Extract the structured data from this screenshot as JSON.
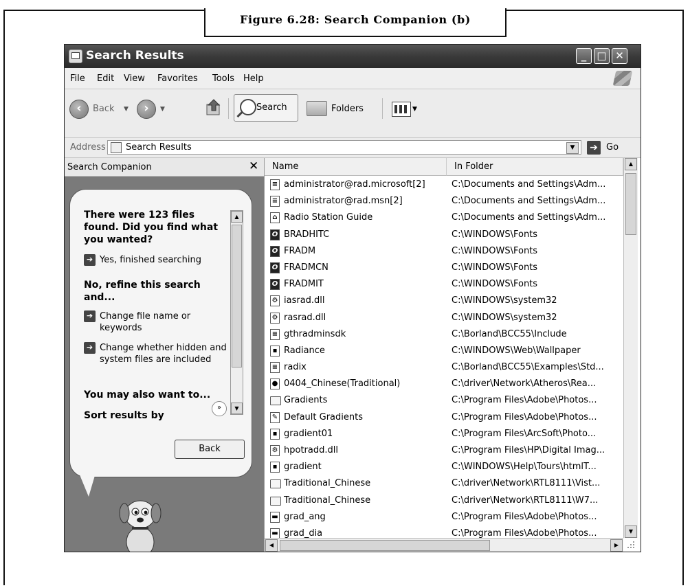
{
  "figure": {
    "caption": "Figure 6.28: Search Companion (b)"
  },
  "window": {
    "title": "Search Results"
  },
  "menu": [
    "File",
    "Edit",
    "View",
    "Favorites",
    "Tools",
    "Help"
  ],
  "toolbar": {
    "back": "Back",
    "search": "Search",
    "folders": "Folders"
  },
  "address": {
    "label": "Address",
    "value": "Search Results",
    "go": "Go"
  },
  "companion": {
    "panel_title": "Search Companion",
    "heading_found": "There were 123 files found. Did you find what you wanted?",
    "link_finished": "Yes, finished searching",
    "heading_refine": "No, refine this search and...",
    "link_change_name": "Change file name or keywords",
    "link_change_hidden": "Change whether hidden and system files are included",
    "heading_also": "You may also want to...",
    "heading_sort": "Sort results by category",
    "back_button": "Back"
  },
  "list": {
    "columns": {
      "name": "Name",
      "folder": "In Folder"
    },
    "rows": [
      {
        "name": "administrator@rad.microsoft[2]",
        "folder": "C:\\Documents and Settings\\Adm...",
        "icon": "text-file-icon"
      },
      {
        "name": "administrator@rad.msn[2]",
        "folder": "C:\\Documents and Settings\\Adm...",
        "icon": "text-file-icon"
      },
      {
        "name": "Radio Station Guide",
        "folder": "C:\\Documents and Settings\\Adm...",
        "icon": "shortcut-icon"
      },
      {
        "name": "BRADHITC",
        "folder": "C:\\WINDOWS\\Fonts",
        "icon": "font-icon"
      },
      {
        "name": "FRADM",
        "folder": "C:\\WINDOWS\\Fonts",
        "icon": "font-icon"
      },
      {
        "name": "FRADMCN",
        "folder": "C:\\WINDOWS\\Fonts",
        "icon": "font-icon"
      },
      {
        "name": "FRADMIT",
        "folder": "C:\\WINDOWS\\Fonts",
        "icon": "font-icon"
      },
      {
        "name": "iasrad.dll",
        "folder": "C:\\WINDOWS\\system32",
        "icon": "dll-icon"
      },
      {
        "name": "rasrad.dll",
        "folder": "C:\\WINDOWS\\system32",
        "icon": "dll-icon"
      },
      {
        "name": "gthradminsdk",
        "folder": "C:\\Borland\\BCC55\\Include",
        "icon": "text-file-icon"
      },
      {
        "name": "Radiance",
        "folder": "C:\\WINDOWS\\Web\\Wallpaper",
        "icon": "image-icon"
      },
      {
        "name": "radix",
        "folder": "C:\\Borland\\BCC55\\Examples\\Std...",
        "icon": "text-file-icon"
      },
      {
        "name": "0404_Chinese(Traditional)",
        "folder": "C:\\driver\\Network\\Atheros\\Rea...",
        "icon": "media-icon"
      },
      {
        "name": "Gradients",
        "folder": "C:\\Program Files\\Adobe\\Photos...",
        "icon": "folder-icon"
      },
      {
        "name": "Default Gradients",
        "folder": "C:\\Program Files\\Adobe\\Photos...",
        "icon": "photoshop-icon"
      },
      {
        "name": "gradient01",
        "folder": "C:\\Program Files\\ArcSoft\\Photo...",
        "icon": "image-icon"
      },
      {
        "name": "hpotradd.dll",
        "folder": "C:\\Program Files\\HP\\Digital Imag...",
        "icon": "dll-icon"
      },
      {
        "name": "gradient",
        "folder": "C:\\WINDOWS\\Help\\Tours\\htmlT...",
        "icon": "image-icon"
      },
      {
        "name": "Traditional_Chinese",
        "folder": "C:\\driver\\Network\\RTL8111\\Vist...",
        "icon": "folder-icon"
      },
      {
        "name": "Traditional_Chinese",
        "folder": "C:\\driver\\Network\\RTL8111\\W7...",
        "icon": "folder-icon"
      },
      {
        "name": "grad_ang",
        "folder": "C:\\Program Files\\Adobe\\Photos...",
        "icon": "generic-file-icon"
      },
      {
        "name": "grad_dia",
        "folder": "C:\\Program Files\\Adobe\\Photos...",
        "icon": "generic-file-icon"
      }
    ]
  }
}
